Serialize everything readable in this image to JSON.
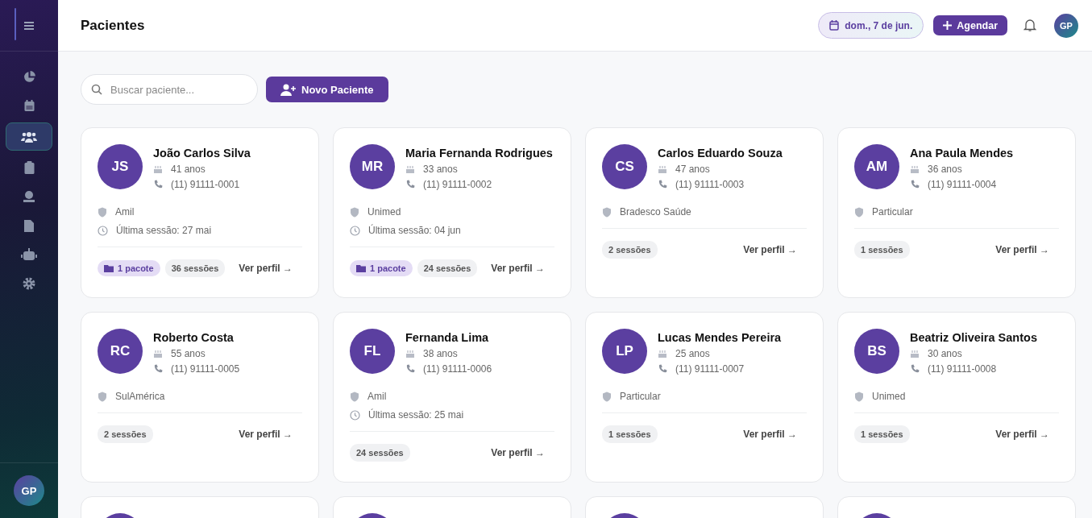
{
  "sidebar": {
    "items": [
      {
        "selected": false
      },
      {
        "selected": false
      },
      {
        "selected": true
      },
      {
        "selected": false
      },
      {
        "selected": false
      },
      {
        "selected": false
      },
      {
        "selected": false
      },
      {
        "selected": false
      }
    ],
    "user_initials": "GP"
  },
  "header": {
    "title": "Pacientes",
    "date": "dom., 7 de jun.",
    "schedule_button": "Agendar",
    "user_initials": "GP"
  },
  "search": {
    "placeholder": "Buscar paciente..."
  },
  "new_button": "Novo Paciente",
  "patients": [
    {
      "initials": "JS",
      "name": "João Carlos Silva",
      "age": "41 anos",
      "phone": "(11) 91111-0001",
      "insurance": "Amil",
      "last_session": "Última sessão: 27 mai",
      "package": "1 pacote",
      "sessions": "36 sessões",
      "link": "Ver perfil →"
    },
    {
      "initials": "MR",
      "name": "Maria Fernanda Rodrigues",
      "age": "33 anos",
      "phone": "(11) 91111-0002",
      "insurance": "Unimed",
      "last_session": "Última sessão: 04 jun",
      "package": "1 pacote",
      "sessions": "24 sessões",
      "link": "Ver perfil →"
    },
    {
      "initials": "CS",
      "name": "Carlos Eduardo Souza",
      "age": "47 anos",
      "phone": "(11) 91111-0003",
      "insurance": "Bradesco Saúde",
      "sessions": "2 sessões",
      "link": "Ver perfil →"
    },
    {
      "initials": "AM",
      "name": "Ana Paula Mendes",
      "age": "36 anos",
      "phone": "(11) 91111-0004",
      "insurance": "Particular",
      "sessions": "1 sessões",
      "link": "Ver perfil →"
    },
    {
      "initials": "RC",
      "name": "Roberto Costa",
      "age": "55 anos",
      "phone": "(11) 91111-0005",
      "insurance": "SulAmérica",
      "sessions": "2 sessões",
      "link": "Ver perfil →"
    },
    {
      "initials": "FL",
      "name": "Fernanda Lima",
      "age": "38 anos",
      "phone": "(11) 91111-0006",
      "insurance": "Amil",
      "last_session": "Última sessão: 25 mai",
      "sessions": "24 sessões",
      "link": "Ver perfil →"
    },
    {
      "initials": "LP",
      "name": "Lucas Mendes Pereira",
      "age": "25 anos",
      "phone": "(11) 91111-0007",
      "insurance": "Particular",
      "sessions": "1 sessões",
      "link": "Ver perfil →"
    },
    {
      "initials": "BS",
      "name": "Beatriz Oliveira Santos",
      "age": "30 anos",
      "phone": "(11) 91111-0008",
      "insurance": "Unimed",
      "sessions": "1 sessões",
      "link": "Ver perfil →"
    }
  ]
}
